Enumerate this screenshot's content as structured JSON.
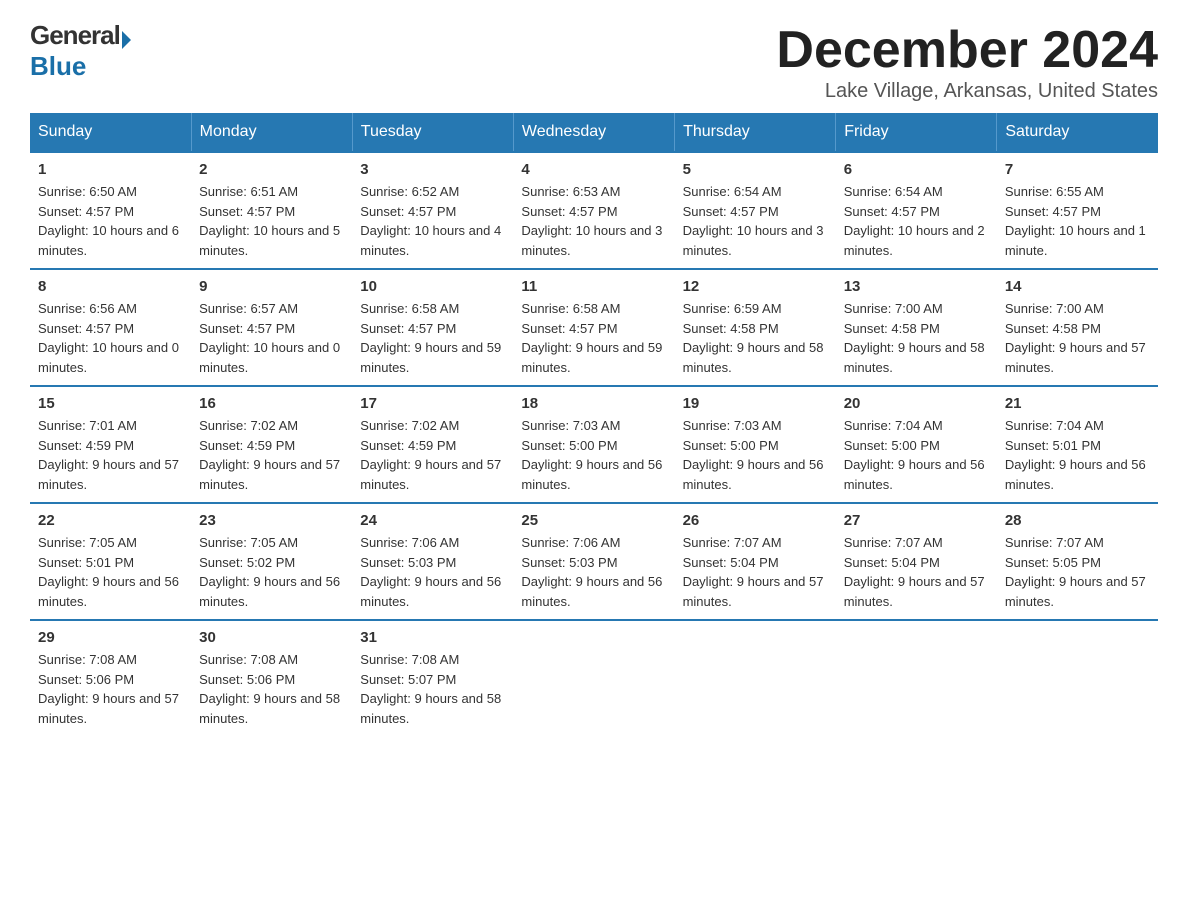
{
  "header": {
    "logo_general": "General",
    "logo_blue": "Blue",
    "title": "December 2024",
    "subtitle": "Lake Village, Arkansas, United States"
  },
  "days_of_week": [
    "Sunday",
    "Monday",
    "Tuesday",
    "Wednesday",
    "Thursday",
    "Friday",
    "Saturday"
  ],
  "weeks": [
    [
      {
        "day": "1",
        "sunrise": "Sunrise: 6:50 AM",
        "sunset": "Sunset: 4:57 PM",
        "daylight": "Daylight: 10 hours and 6 minutes."
      },
      {
        "day": "2",
        "sunrise": "Sunrise: 6:51 AM",
        "sunset": "Sunset: 4:57 PM",
        "daylight": "Daylight: 10 hours and 5 minutes."
      },
      {
        "day": "3",
        "sunrise": "Sunrise: 6:52 AM",
        "sunset": "Sunset: 4:57 PM",
        "daylight": "Daylight: 10 hours and 4 minutes."
      },
      {
        "day": "4",
        "sunrise": "Sunrise: 6:53 AM",
        "sunset": "Sunset: 4:57 PM",
        "daylight": "Daylight: 10 hours and 3 minutes."
      },
      {
        "day": "5",
        "sunrise": "Sunrise: 6:54 AM",
        "sunset": "Sunset: 4:57 PM",
        "daylight": "Daylight: 10 hours and 3 minutes."
      },
      {
        "day": "6",
        "sunrise": "Sunrise: 6:54 AM",
        "sunset": "Sunset: 4:57 PM",
        "daylight": "Daylight: 10 hours and 2 minutes."
      },
      {
        "day": "7",
        "sunrise": "Sunrise: 6:55 AM",
        "sunset": "Sunset: 4:57 PM",
        "daylight": "Daylight: 10 hours and 1 minute."
      }
    ],
    [
      {
        "day": "8",
        "sunrise": "Sunrise: 6:56 AM",
        "sunset": "Sunset: 4:57 PM",
        "daylight": "Daylight: 10 hours and 0 minutes."
      },
      {
        "day": "9",
        "sunrise": "Sunrise: 6:57 AM",
        "sunset": "Sunset: 4:57 PM",
        "daylight": "Daylight: 10 hours and 0 minutes."
      },
      {
        "day": "10",
        "sunrise": "Sunrise: 6:58 AM",
        "sunset": "Sunset: 4:57 PM",
        "daylight": "Daylight: 9 hours and 59 minutes."
      },
      {
        "day": "11",
        "sunrise": "Sunrise: 6:58 AM",
        "sunset": "Sunset: 4:57 PM",
        "daylight": "Daylight: 9 hours and 59 minutes."
      },
      {
        "day": "12",
        "sunrise": "Sunrise: 6:59 AM",
        "sunset": "Sunset: 4:58 PM",
        "daylight": "Daylight: 9 hours and 58 minutes."
      },
      {
        "day": "13",
        "sunrise": "Sunrise: 7:00 AM",
        "sunset": "Sunset: 4:58 PM",
        "daylight": "Daylight: 9 hours and 58 minutes."
      },
      {
        "day": "14",
        "sunrise": "Sunrise: 7:00 AM",
        "sunset": "Sunset: 4:58 PM",
        "daylight": "Daylight: 9 hours and 57 minutes."
      }
    ],
    [
      {
        "day": "15",
        "sunrise": "Sunrise: 7:01 AM",
        "sunset": "Sunset: 4:59 PM",
        "daylight": "Daylight: 9 hours and 57 minutes."
      },
      {
        "day": "16",
        "sunrise": "Sunrise: 7:02 AM",
        "sunset": "Sunset: 4:59 PM",
        "daylight": "Daylight: 9 hours and 57 minutes."
      },
      {
        "day": "17",
        "sunrise": "Sunrise: 7:02 AM",
        "sunset": "Sunset: 4:59 PM",
        "daylight": "Daylight: 9 hours and 57 minutes."
      },
      {
        "day": "18",
        "sunrise": "Sunrise: 7:03 AM",
        "sunset": "Sunset: 5:00 PM",
        "daylight": "Daylight: 9 hours and 56 minutes."
      },
      {
        "day": "19",
        "sunrise": "Sunrise: 7:03 AM",
        "sunset": "Sunset: 5:00 PM",
        "daylight": "Daylight: 9 hours and 56 minutes."
      },
      {
        "day": "20",
        "sunrise": "Sunrise: 7:04 AM",
        "sunset": "Sunset: 5:00 PM",
        "daylight": "Daylight: 9 hours and 56 minutes."
      },
      {
        "day": "21",
        "sunrise": "Sunrise: 7:04 AM",
        "sunset": "Sunset: 5:01 PM",
        "daylight": "Daylight: 9 hours and 56 minutes."
      }
    ],
    [
      {
        "day": "22",
        "sunrise": "Sunrise: 7:05 AM",
        "sunset": "Sunset: 5:01 PM",
        "daylight": "Daylight: 9 hours and 56 minutes."
      },
      {
        "day": "23",
        "sunrise": "Sunrise: 7:05 AM",
        "sunset": "Sunset: 5:02 PM",
        "daylight": "Daylight: 9 hours and 56 minutes."
      },
      {
        "day": "24",
        "sunrise": "Sunrise: 7:06 AM",
        "sunset": "Sunset: 5:03 PM",
        "daylight": "Daylight: 9 hours and 56 minutes."
      },
      {
        "day": "25",
        "sunrise": "Sunrise: 7:06 AM",
        "sunset": "Sunset: 5:03 PM",
        "daylight": "Daylight: 9 hours and 56 minutes."
      },
      {
        "day": "26",
        "sunrise": "Sunrise: 7:07 AM",
        "sunset": "Sunset: 5:04 PM",
        "daylight": "Daylight: 9 hours and 57 minutes."
      },
      {
        "day": "27",
        "sunrise": "Sunrise: 7:07 AM",
        "sunset": "Sunset: 5:04 PM",
        "daylight": "Daylight: 9 hours and 57 minutes."
      },
      {
        "day": "28",
        "sunrise": "Sunrise: 7:07 AM",
        "sunset": "Sunset: 5:05 PM",
        "daylight": "Daylight: 9 hours and 57 minutes."
      }
    ],
    [
      {
        "day": "29",
        "sunrise": "Sunrise: 7:08 AM",
        "sunset": "Sunset: 5:06 PM",
        "daylight": "Daylight: 9 hours and 57 minutes."
      },
      {
        "day": "30",
        "sunrise": "Sunrise: 7:08 AM",
        "sunset": "Sunset: 5:06 PM",
        "daylight": "Daylight: 9 hours and 58 minutes."
      },
      {
        "day": "31",
        "sunrise": "Sunrise: 7:08 AM",
        "sunset": "Sunset: 5:07 PM",
        "daylight": "Daylight: 9 hours and 58 minutes."
      },
      null,
      null,
      null,
      null
    ]
  ]
}
